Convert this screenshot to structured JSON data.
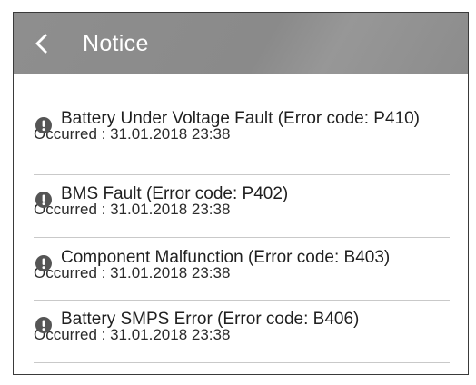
{
  "header": {
    "title": "Notice",
    "back_icon": "chevron-left-icon",
    "background_color": "#8c8c8c"
  },
  "notices": [
    {
      "message": "Battery Under Voltage Fault (Error code: P410)",
      "occurred": "Occurred : 31.01.2018 23:38",
      "icon": "alert-icon"
    },
    {
      "message": "BMS Fault (Error code: P402)",
      "occurred": "Occurred : 31.01.2018 23:38",
      "icon": "alert-icon"
    },
    {
      "message": "Component Malfunction (Error code: B403)",
      "occurred": "Occurred : 31.01.2018 23:38",
      "icon": "alert-icon"
    },
    {
      "message": "Battery SMPS Error (Error code: B406)",
      "occurred": "Occurred : 31.01.2018 23:38",
      "icon": "alert-icon"
    }
  ]
}
